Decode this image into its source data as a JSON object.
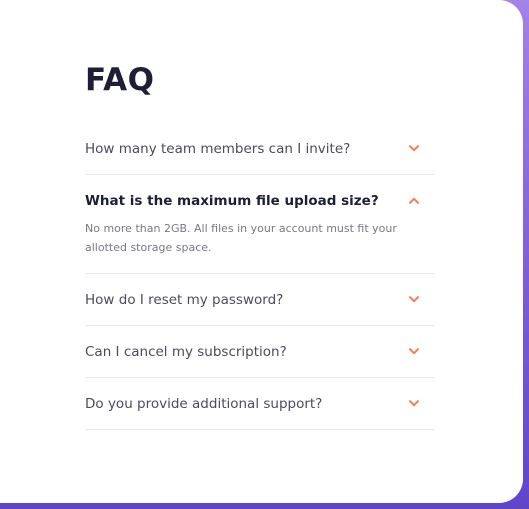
{
  "title": "FAQ",
  "accent_color": "#f47c57",
  "items": [
    {
      "question": "How many team members can I invite?",
      "expanded": false
    },
    {
      "question": "What is the maximum file upload size?",
      "expanded": true,
      "answer": "No more than 2GB. All files in your account must fit your allotted storage space."
    },
    {
      "question": "How do I reset my password?",
      "expanded": false
    },
    {
      "question": "Can I cancel my subscription?",
      "expanded": false
    },
    {
      "question": "Do you provide additional support?",
      "expanded": false
    }
  ]
}
